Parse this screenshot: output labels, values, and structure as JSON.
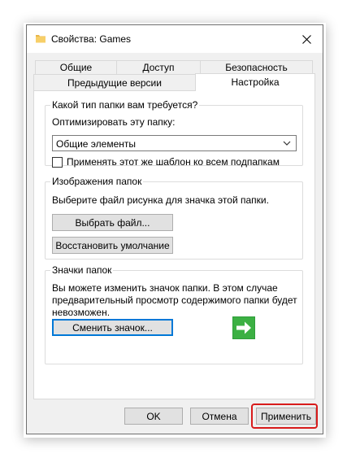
{
  "window": {
    "title": "Свойства: Games",
    "folder_icon": "folder-icon",
    "close_icon": "close-icon"
  },
  "tabs": {
    "row1": [
      {
        "label": "Общие"
      },
      {
        "label": "Доступ"
      },
      {
        "label": "Безопасность"
      }
    ],
    "row2": [
      {
        "label": "Предыдущие версии"
      },
      {
        "label": "Настройка",
        "active": true
      }
    ]
  },
  "folder_type": {
    "legend": "Какой тип папки вам требуется?",
    "optimize_label": "Оптимизировать эту папку:",
    "selected_value": "Общие элементы",
    "apply_template_label": "Применять этот же шаблон ко всем подпапкам",
    "apply_template_checked": false
  },
  "folder_pictures": {
    "legend": "Изображения папок",
    "description": "Выберите файл рисунка для значка этой папки.",
    "choose_file_button": "Выбрать файл...",
    "restore_default_button": "Восстановить умолчание"
  },
  "folder_icons": {
    "legend": "Значки папок",
    "description_line1": "Вы можете изменить значок папки. В этом случае",
    "description_line2": "предварительный просмотр содержимого папки будет",
    "description_line3": "невозможен.",
    "change_icon_button": "Сменить значок...",
    "preview_icon": "green-arrow-right-icon"
  },
  "footer": {
    "ok_button": "OK",
    "cancel_button": "Отмена",
    "apply_button": "Применить"
  },
  "colors": {
    "highlight": "#d81b1b",
    "focus": "#0078d7",
    "arrow_green": "#3cb043"
  }
}
